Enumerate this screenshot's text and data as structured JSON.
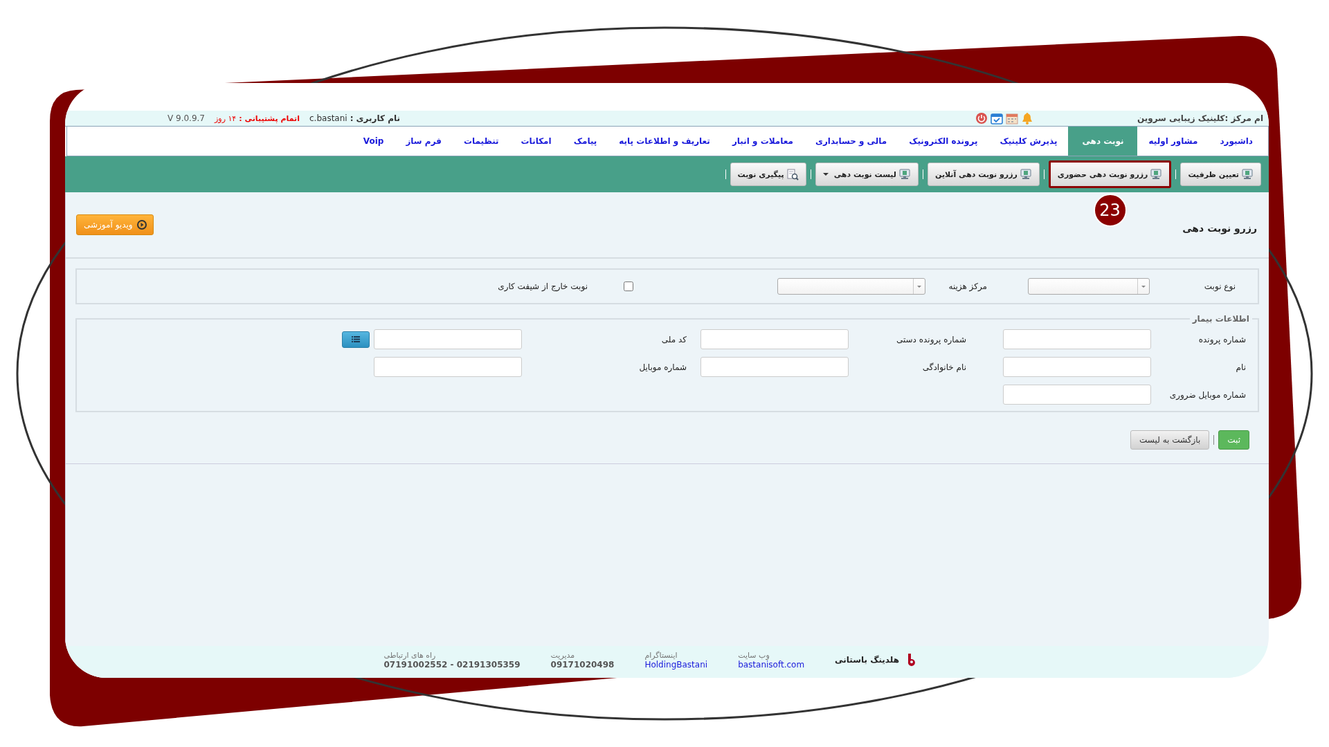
{
  "top_bar": {
    "center_name": "ام مرکز :کلینیک زیبایی سروین",
    "user_label": "نام کاربری :",
    "user": "c.bastani",
    "support_label": "اتمام پشتیبانی :",
    "support_value": "۱۴ روز",
    "version": "V 9.0.9.7"
  },
  "nav": [
    {
      "label": "داشبورد",
      "selected": false
    },
    {
      "label": "مشاور اولیه",
      "selected": false
    },
    {
      "label": "نوبت دهی",
      "selected": true
    },
    {
      "label": "پذیرش کلینیک",
      "selected": false
    },
    {
      "label": "پرونده الکترونیک",
      "selected": false
    },
    {
      "label": "مالی و حسابداری",
      "selected": false
    },
    {
      "label": "معاملات و انبار",
      "selected": false
    },
    {
      "label": "تعاریف و اطلاعات پایه",
      "selected": false
    },
    {
      "label": "پیامک",
      "selected": false
    },
    {
      "label": "امکانات",
      "selected": false
    },
    {
      "label": "تنظیمات",
      "selected": false
    },
    {
      "label": "فرم ساز",
      "selected": false
    },
    {
      "label": "Voip",
      "selected": false
    }
  ],
  "toolbar": [
    {
      "label": "تعیین ظرفیت",
      "kind": "monitor",
      "highlighted": false,
      "dropdown": false
    },
    {
      "label": "رزرو نوبت دهی حضوری",
      "kind": "monitor",
      "highlighted": true,
      "dropdown": false
    },
    {
      "label": "رزرو نوبت دهی آنلاین",
      "kind": "monitor",
      "highlighted": false,
      "dropdown": false
    },
    {
      "label": "لیست نوبت دهی",
      "kind": "monitor",
      "highlighted": false,
      "dropdown": true
    },
    {
      "label": "پیگیری نوبت",
      "kind": "search",
      "highlighted": false,
      "dropdown": false
    }
  ],
  "annotation_badge": "23",
  "page_title": "رزرو نوبت دهی",
  "video_button": "ویدیو آموزشی",
  "appointment": {
    "type_label": "نوع نوبت",
    "cost_center_label": "مرکز هزینه",
    "off_shift_label": "نوبت خارج از شیفت کاری",
    "off_shift_checked": false
  },
  "patient": {
    "legend": "اطلاعات بیمار",
    "fields": [
      {
        "label": "شماره پرونده",
        "kind": "text"
      },
      {
        "label": "شماره پرونده دستی",
        "kind": "text"
      },
      {
        "label": "کد ملی",
        "kind": "lookup"
      },
      {
        "label": "نام",
        "kind": "text"
      },
      {
        "label": "نام خانوادگی",
        "kind": "text"
      },
      {
        "label": "شماره موبایل",
        "kind": "text"
      },
      {
        "label": "شماره موبایل ضروری",
        "kind": "text"
      }
    ]
  },
  "buttons": [
    {
      "label": "ثبت",
      "kind": "primary"
    },
    {
      "label": "بازگشت به لیست",
      "kind": "secondary"
    }
  ],
  "footer": {
    "company": "هلدینگ باستانی",
    "contacts": [
      {
        "label": "وب سایت",
        "value": "bastanisoft.com",
        "kind": "link"
      },
      {
        "label": "اینستاگرام",
        "value": "HoldingBastani",
        "kind": "link"
      },
      {
        "label": "مدیریت",
        "value": "09171020498",
        "kind": "plain"
      },
      {
        "label": "راه های ارتباطی",
        "value": "07191002552 - 02191305359",
        "kind": "plain"
      }
    ]
  }
}
